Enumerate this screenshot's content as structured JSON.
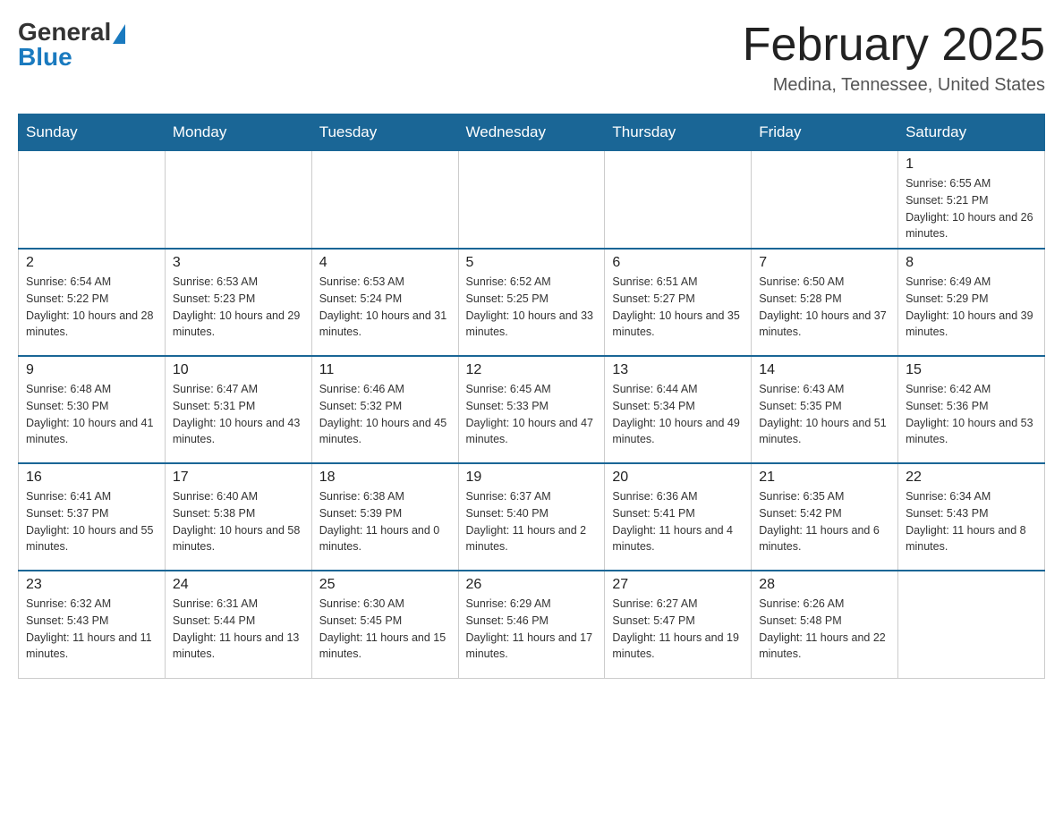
{
  "logo": {
    "general": "General",
    "blue": "Blue"
  },
  "title": "February 2025",
  "location": "Medina, Tennessee, United States",
  "days_of_week": [
    "Sunday",
    "Monday",
    "Tuesday",
    "Wednesday",
    "Thursday",
    "Friday",
    "Saturday"
  ],
  "weeks": [
    [
      {
        "day": "",
        "info": ""
      },
      {
        "day": "",
        "info": ""
      },
      {
        "day": "",
        "info": ""
      },
      {
        "day": "",
        "info": ""
      },
      {
        "day": "",
        "info": ""
      },
      {
        "day": "",
        "info": ""
      },
      {
        "day": "1",
        "info": "Sunrise: 6:55 AM\nSunset: 5:21 PM\nDaylight: 10 hours and 26 minutes."
      }
    ],
    [
      {
        "day": "2",
        "info": "Sunrise: 6:54 AM\nSunset: 5:22 PM\nDaylight: 10 hours and 28 minutes."
      },
      {
        "day": "3",
        "info": "Sunrise: 6:53 AM\nSunset: 5:23 PM\nDaylight: 10 hours and 29 minutes."
      },
      {
        "day": "4",
        "info": "Sunrise: 6:53 AM\nSunset: 5:24 PM\nDaylight: 10 hours and 31 minutes."
      },
      {
        "day": "5",
        "info": "Sunrise: 6:52 AM\nSunset: 5:25 PM\nDaylight: 10 hours and 33 minutes."
      },
      {
        "day": "6",
        "info": "Sunrise: 6:51 AM\nSunset: 5:27 PM\nDaylight: 10 hours and 35 minutes."
      },
      {
        "day": "7",
        "info": "Sunrise: 6:50 AM\nSunset: 5:28 PM\nDaylight: 10 hours and 37 minutes."
      },
      {
        "day": "8",
        "info": "Sunrise: 6:49 AM\nSunset: 5:29 PM\nDaylight: 10 hours and 39 minutes."
      }
    ],
    [
      {
        "day": "9",
        "info": "Sunrise: 6:48 AM\nSunset: 5:30 PM\nDaylight: 10 hours and 41 minutes."
      },
      {
        "day": "10",
        "info": "Sunrise: 6:47 AM\nSunset: 5:31 PM\nDaylight: 10 hours and 43 minutes."
      },
      {
        "day": "11",
        "info": "Sunrise: 6:46 AM\nSunset: 5:32 PM\nDaylight: 10 hours and 45 minutes."
      },
      {
        "day": "12",
        "info": "Sunrise: 6:45 AM\nSunset: 5:33 PM\nDaylight: 10 hours and 47 minutes."
      },
      {
        "day": "13",
        "info": "Sunrise: 6:44 AM\nSunset: 5:34 PM\nDaylight: 10 hours and 49 minutes."
      },
      {
        "day": "14",
        "info": "Sunrise: 6:43 AM\nSunset: 5:35 PM\nDaylight: 10 hours and 51 minutes."
      },
      {
        "day": "15",
        "info": "Sunrise: 6:42 AM\nSunset: 5:36 PM\nDaylight: 10 hours and 53 minutes."
      }
    ],
    [
      {
        "day": "16",
        "info": "Sunrise: 6:41 AM\nSunset: 5:37 PM\nDaylight: 10 hours and 55 minutes."
      },
      {
        "day": "17",
        "info": "Sunrise: 6:40 AM\nSunset: 5:38 PM\nDaylight: 10 hours and 58 minutes."
      },
      {
        "day": "18",
        "info": "Sunrise: 6:38 AM\nSunset: 5:39 PM\nDaylight: 11 hours and 0 minutes."
      },
      {
        "day": "19",
        "info": "Sunrise: 6:37 AM\nSunset: 5:40 PM\nDaylight: 11 hours and 2 minutes."
      },
      {
        "day": "20",
        "info": "Sunrise: 6:36 AM\nSunset: 5:41 PM\nDaylight: 11 hours and 4 minutes."
      },
      {
        "day": "21",
        "info": "Sunrise: 6:35 AM\nSunset: 5:42 PM\nDaylight: 11 hours and 6 minutes."
      },
      {
        "day": "22",
        "info": "Sunrise: 6:34 AM\nSunset: 5:43 PM\nDaylight: 11 hours and 8 minutes."
      }
    ],
    [
      {
        "day": "23",
        "info": "Sunrise: 6:32 AM\nSunset: 5:43 PM\nDaylight: 11 hours and 11 minutes."
      },
      {
        "day": "24",
        "info": "Sunrise: 6:31 AM\nSunset: 5:44 PM\nDaylight: 11 hours and 13 minutes."
      },
      {
        "day": "25",
        "info": "Sunrise: 6:30 AM\nSunset: 5:45 PM\nDaylight: 11 hours and 15 minutes."
      },
      {
        "day": "26",
        "info": "Sunrise: 6:29 AM\nSunset: 5:46 PM\nDaylight: 11 hours and 17 minutes."
      },
      {
        "day": "27",
        "info": "Sunrise: 6:27 AM\nSunset: 5:47 PM\nDaylight: 11 hours and 19 minutes."
      },
      {
        "day": "28",
        "info": "Sunrise: 6:26 AM\nSunset: 5:48 PM\nDaylight: 11 hours and 22 minutes."
      },
      {
        "day": "",
        "info": ""
      }
    ]
  ]
}
